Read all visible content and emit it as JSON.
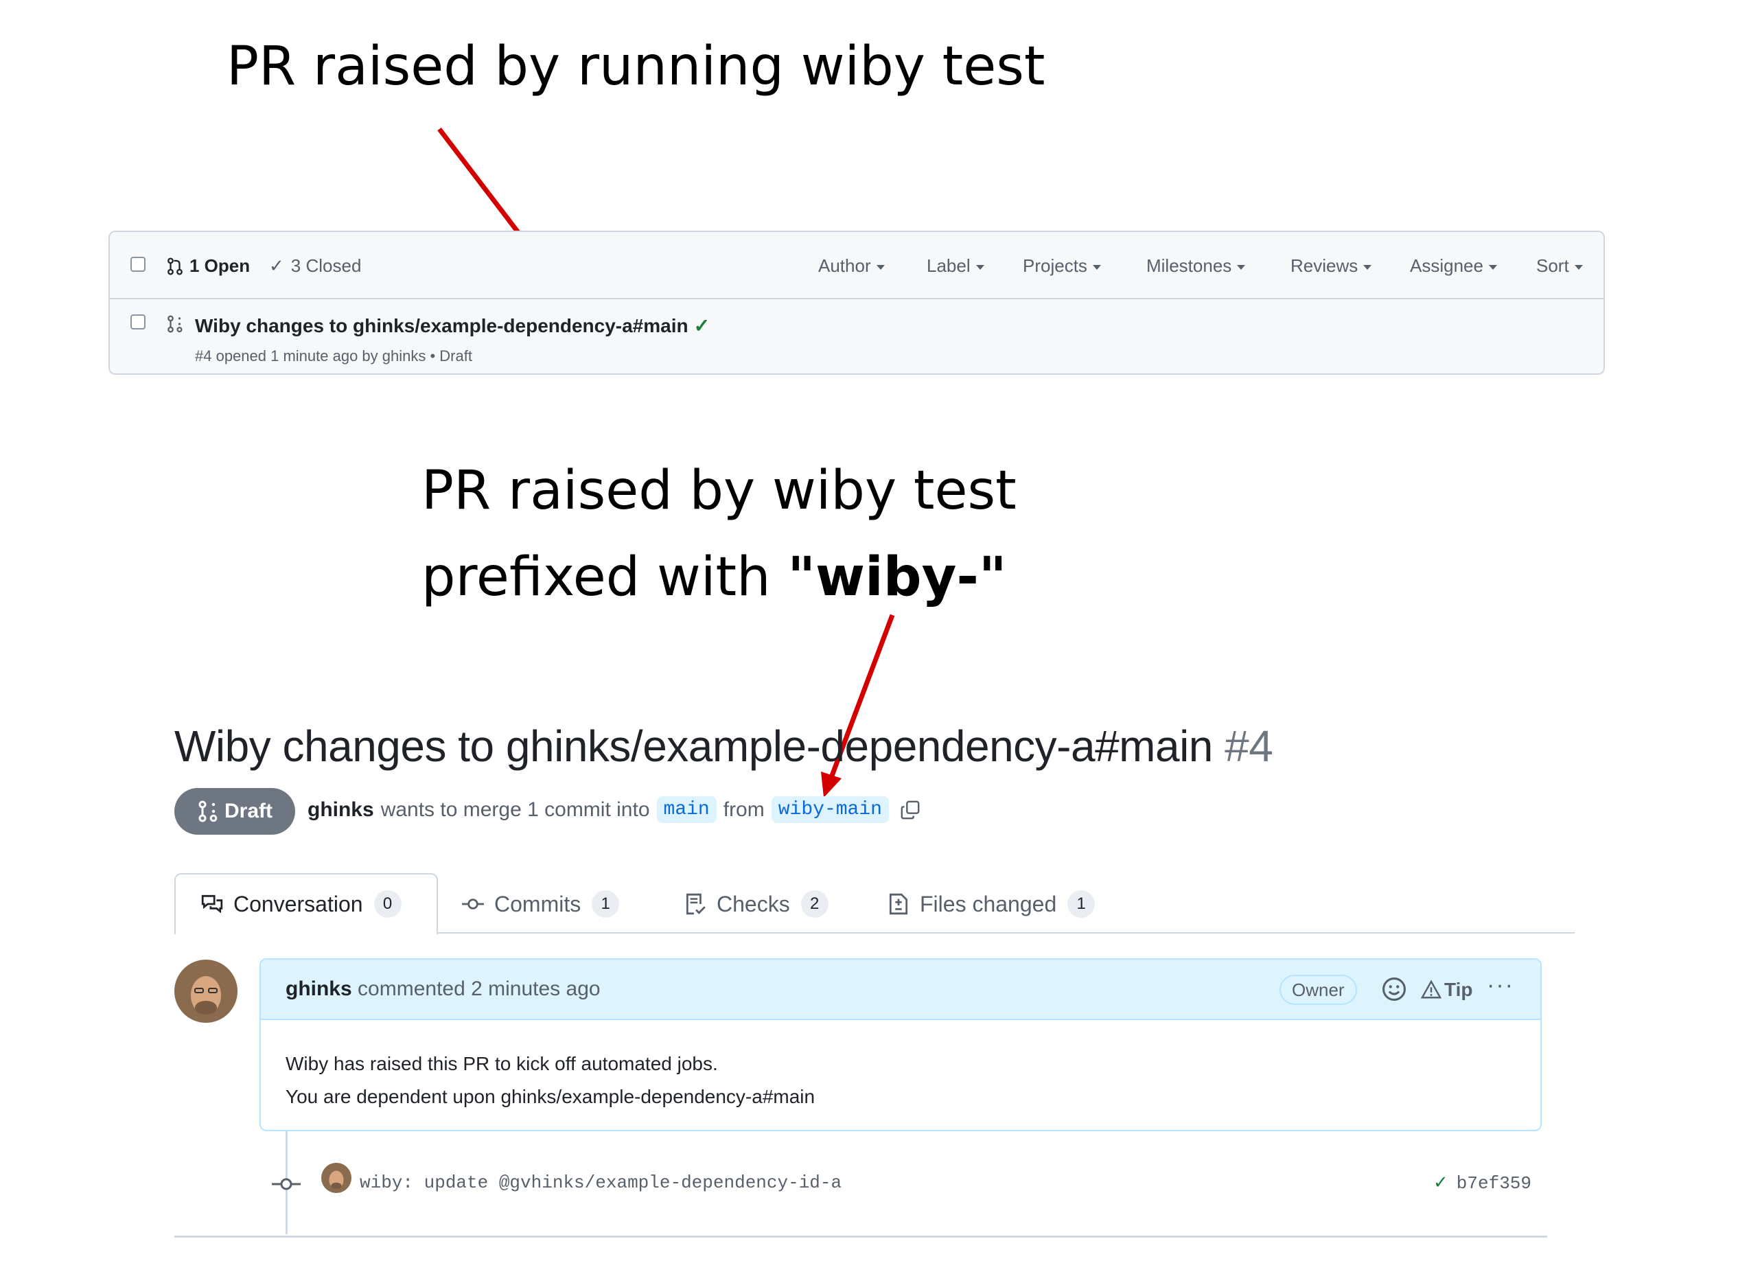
{
  "annotations": {
    "top": "PR raised by running wiby test",
    "middle_line1": "PR raised by wiby test",
    "middle_line2_prefix": "prefixed with ",
    "middle_line2_bold": "\"wiby-\""
  },
  "pr_list": {
    "open_label": "1 Open",
    "closed_label": "3 Closed",
    "filters": [
      "Author",
      "Label",
      "Projects",
      "Milestones",
      "Reviews",
      "Assignee",
      "Sort"
    ],
    "row": {
      "title": "Wiby changes to ghinks/example-dependency-a#main",
      "check": "✓",
      "meta": "#4 opened 1 minute ago by ghinks • Draft"
    }
  },
  "pr_page": {
    "title": "Wiby changes to ghinks/example-dependency-a#main",
    "number": "#4",
    "state": "Draft",
    "author": "ghinks",
    "merge_text": "wants to merge 1 commit into",
    "base_branch": "main",
    "from_text": "from",
    "head_branch": "wiby-main",
    "tabs": [
      {
        "label": "Conversation",
        "count": "0"
      },
      {
        "label": "Commits",
        "count": "1"
      },
      {
        "label": "Checks",
        "count": "2"
      },
      {
        "label": "Files changed",
        "count": "1"
      }
    ],
    "comment": {
      "author": "ghinks",
      "action": "commented 2 minutes ago",
      "role": "Owner",
      "tip": "Tip",
      "more": "···",
      "body_line1": "Wiby has raised this PR to kick off automated jobs.",
      "body_line2": "You are dependent upon ghinks/example-dependency-a#main"
    },
    "commit": {
      "message": "wiby: update @gvhinks/example-dependency-id-a",
      "status": "✓",
      "sha": "b7ef359"
    }
  },
  "colors": {
    "arrow": "#d40000",
    "link": "#0969da",
    "success": "#1a7f37",
    "draft": "#6e7781"
  }
}
